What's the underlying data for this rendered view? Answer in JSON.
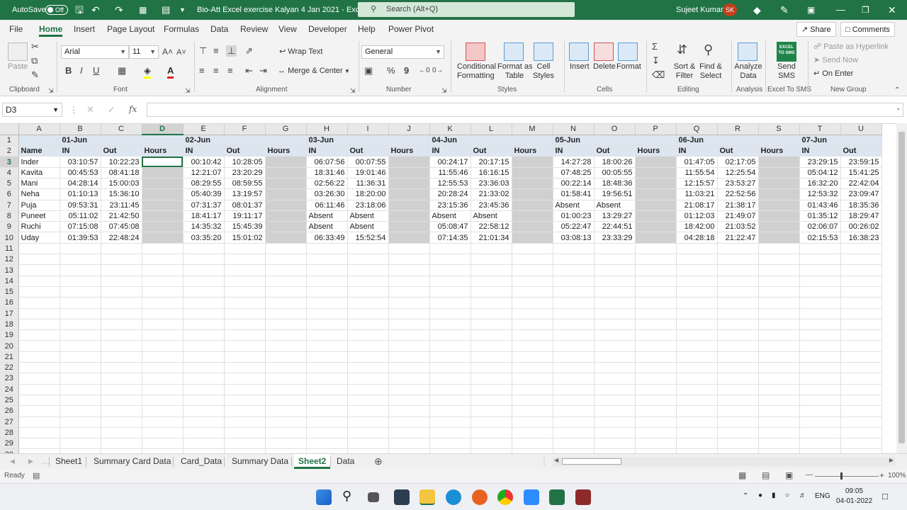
{
  "titlebar": {
    "autosave_label": "AutoSave",
    "autosave_state": "Off",
    "doc_title": "Bio-Att Excel exercise Kalyan 4 Jan 2021  -  Excel",
    "search_placeholder": "Search (Alt+Q)",
    "user_name": "Sujeet Kumar",
    "user_initials": "SK"
  },
  "ribbon_tabs": [
    "File",
    "Home",
    "Insert",
    "Page Layout",
    "Formulas",
    "Data",
    "Review",
    "View",
    "Developer",
    "Help",
    "Power Pivot"
  ],
  "active_tab": "Home",
  "share_label": "Share",
  "comments_label": "Comments",
  "ribbon": {
    "clipboard": {
      "paste": "Paste",
      "group": "Clipboard"
    },
    "font": {
      "name": "Arial",
      "size": "11",
      "group": "Font",
      "bold": "B",
      "italic": "I",
      "underline": "U"
    },
    "alignment": {
      "wrap": "Wrap Text",
      "merge": "Merge & Center",
      "group": "Alignment"
    },
    "number": {
      "format": "General",
      "group": "Number",
      "percent": "%",
      "comma": "9"
    },
    "styles": {
      "cond1": "Conditional",
      "cond2": "Formatting",
      "fmt1": "Format as",
      "fmt2": "Table",
      "cell1": "Cell",
      "cell2": "Styles",
      "group": "Styles"
    },
    "cells": {
      "insert": "Insert",
      "delete": "Delete",
      "format": "Format",
      "group": "Cells"
    },
    "editing": {
      "sort1": "Sort &",
      "sort2": "Filter",
      "find1": "Find &",
      "find2": "Select",
      "group": "Editing"
    },
    "analysis": {
      "a1": "Analyze",
      "a2": "Data",
      "group": "Analysis"
    },
    "sms": {
      "s1": "Send",
      "s2": "SMS",
      "group": "Excel To SMS",
      "logo": "EXCEL TO SMS"
    },
    "newgroup": {
      "paste_link": "Paste as Hyperlink",
      "send_now": "Send Now",
      "on_enter": "On Enter",
      "group": "New Group"
    }
  },
  "formula_bar": {
    "name_box": "D3",
    "formula": "",
    "fx": "fx"
  },
  "grid": {
    "columns": [
      "A",
      "B",
      "C",
      "D",
      "E",
      "F",
      "G",
      "H",
      "I",
      "J",
      "K",
      "L",
      "M",
      "N",
      "O",
      "P",
      "Q",
      "R",
      "S",
      "T",
      "U"
    ],
    "selected_col": "D",
    "selected_row": "3",
    "row1_dates": [
      "01-Jun",
      "02-Jun",
      "03-Jun",
      "04-Jun",
      "05-Jun",
      "06-Jun",
      "07-Jun"
    ],
    "row2": {
      "name": "Name",
      "in": "IN",
      "out": "Out",
      "hours": "Hours"
    },
    "absent_label": "Absent",
    "people": [
      {
        "name": "Inder",
        "t": [
          [
            "03:10:57",
            "10:22:23"
          ],
          [
            "00:10:42",
            "10:28:05"
          ],
          [
            "06:07:56",
            "00:07:55"
          ],
          [
            "00:24:17",
            "20:17:15"
          ],
          [
            "14:27:28",
            "18:00:26"
          ],
          [
            "01:47:05",
            "02:17:05"
          ],
          [
            "23:29:15",
            "23:59:15"
          ]
        ]
      },
      {
        "name": "Kavita",
        "t": [
          [
            "00:45:53",
            "08:41:18"
          ],
          [
            "12:21:07",
            "23:20:29"
          ],
          [
            "18:31:46",
            "19:01:46"
          ],
          [
            "11:55:46",
            "16:16:15"
          ],
          [
            "07:48:25",
            "00:05:55"
          ],
          [
            "11:55:54",
            "12:25:54"
          ],
          [
            "05:04:12",
            "15:41:25"
          ]
        ]
      },
      {
        "name": "Mani",
        "t": [
          [
            "04:28:14",
            "15:00:03"
          ],
          [
            "08:29:55",
            "08:59:55"
          ],
          [
            "02:56:22",
            "11:36:31"
          ],
          [
            "12:55:53",
            "23:36:03"
          ],
          [
            "00:22:14",
            "18:48:36"
          ],
          [
            "12:15:57",
            "23:53:27"
          ],
          [
            "16:32:20",
            "22:42:04"
          ]
        ]
      },
      {
        "name": "Neha",
        "t": [
          [
            "01:10:13",
            "15:36:10"
          ],
          [
            "05:40:39",
            "13:19:57"
          ],
          [
            "03:26:30",
            "18:20:00"
          ],
          [
            "20:28:24",
            "21:33:02"
          ],
          [
            "01:58:41",
            "19:56:51"
          ],
          [
            "11:03:21",
            "22:52:56"
          ],
          [
            "12:53:32",
            "23:09:47"
          ]
        ]
      },
      {
        "name": "Puja",
        "t": [
          [
            "09:53:31",
            "23:11:45"
          ],
          [
            "07:31:37",
            "08:01:37"
          ],
          [
            "06:11:46",
            "23:18:06"
          ],
          [
            "23:15:36",
            "23:45:36"
          ],
          [
            "Absent",
            "Absent"
          ],
          [
            "21:08:17",
            "21:38:17"
          ],
          [
            "01:43:46",
            "18:35:36"
          ]
        ]
      },
      {
        "name": "Puneet",
        "t": [
          [
            "05:11:02",
            "21:42:50"
          ],
          [
            "18:41:17",
            "19:11:17"
          ],
          [
            "Absent",
            "Absent"
          ],
          [
            "Absent",
            "Absent"
          ],
          [
            "01:00:23",
            "13:29:27"
          ],
          [
            "01:12:03",
            "21:49:07"
          ],
          [
            "01:35:12",
            "18:29:47"
          ]
        ]
      },
      {
        "name": "Ruchi",
        "t": [
          [
            "07:15:08",
            "07:45:08"
          ],
          [
            "14:35:32",
            "15:45:39"
          ],
          [
            "Absent",
            "Absent"
          ],
          [
            "05:08:47",
            "22:58:12"
          ],
          [
            "05:22:47",
            "22:44:51"
          ],
          [
            "18:42:00",
            "21:03:52"
          ],
          [
            "02:06:07",
            "00:26:02"
          ]
        ]
      },
      {
        "name": "Uday",
        "t": [
          [
            "01:39:53",
            "22:48:24"
          ],
          [
            "03:35:20",
            "15:01:02"
          ],
          [
            "06:33:49",
            "15:52:54"
          ],
          [
            "07:14:35",
            "21:01:34"
          ],
          [
            "03:08:13",
            "23:33:29"
          ],
          [
            "04:28:18",
            "21:22:47"
          ],
          [
            "02:15:53",
            "16:38:23"
          ]
        ]
      }
    ],
    "empty_rows_from": 11,
    "empty_rows_to": 30
  },
  "sheet_tabs": [
    "Sheet1",
    "Summary Card Data",
    "Card_Data",
    "Summary Data",
    "Sheet2",
    "Data"
  ],
  "active_sheet": "Sheet2",
  "status": {
    "ready": "Ready",
    "zoom": "100%"
  },
  "taskbar": {
    "lang": "ENG",
    "time": "09:05",
    "date": "04-01-2022"
  },
  "colors": {
    "excel_green": "#217346",
    "header_fill": "#dce6f1",
    "hours_fill": "#d0d0d0"
  }
}
